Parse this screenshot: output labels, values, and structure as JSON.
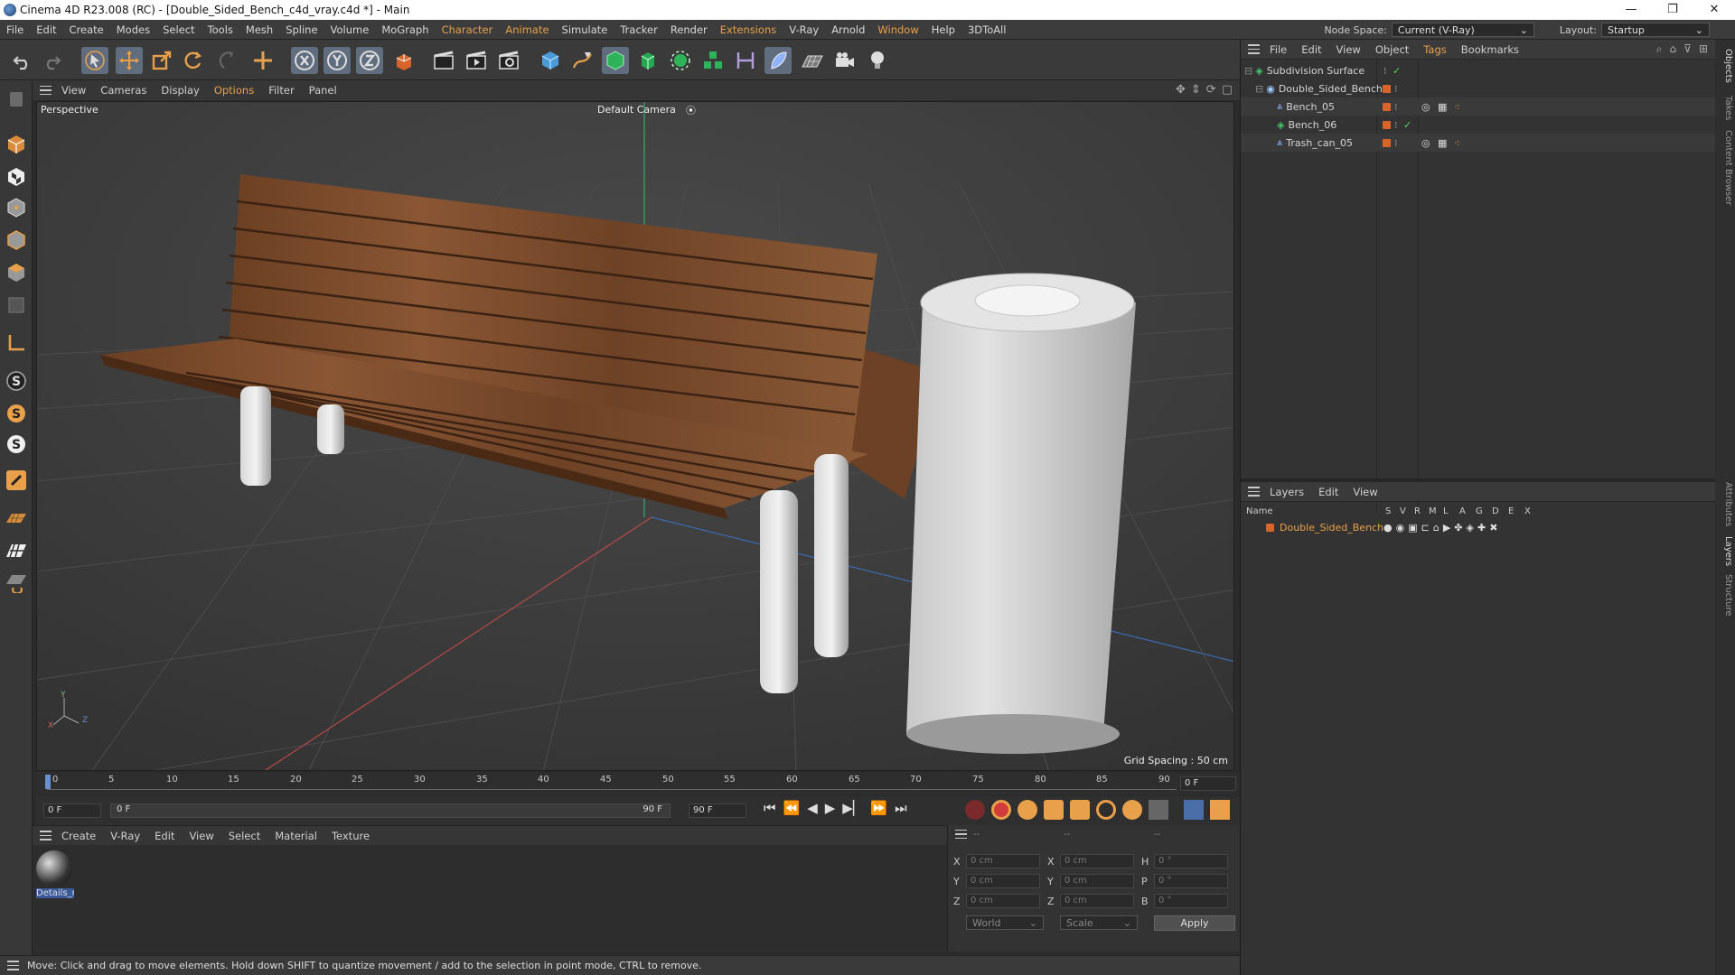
{
  "window": {
    "title": "Cinema 4D R23.008 (RC) - [Double_Sided_Bench_c4d_vray.c4d *] - Main",
    "min": "—",
    "max": "❐",
    "close": "✕"
  },
  "menu": [
    "File",
    "Edit",
    "Create",
    "Modes",
    "Select",
    "Tools",
    "Mesh",
    "Spline",
    "Volume",
    "MoGraph",
    "Character",
    "Animate",
    "Simulate",
    "Tracker",
    "Render",
    "Extensions",
    "V-Ray",
    "Arnold",
    "Window",
    "Help",
    "3DToAll"
  ],
  "node_space": {
    "label": "Node Space:",
    "value": "Current (V-Ray)"
  },
  "layout": {
    "label": "Layout:",
    "value": "Startup"
  },
  "viewport_menu": [
    "View",
    "Cameras",
    "Display",
    "Options",
    "Filter",
    "Panel"
  ],
  "viewport": {
    "name": "Perspective",
    "camera": "Default Camera",
    "grid_spacing": "Grid Spacing : 50 cm",
    "axis_y": "Y",
    "axis_x": "X",
    "axis_z": "Z"
  },
  "timeline": {
    "ticks": [
      "0",
      "5",
      "10",
      "15",
      "20",
      "25",
      "30",
      "35",
      "40",
      "45",
      "50",
      "55",
      "60",
      "65",
      "70",
      "75",
      "80",
      "85",
      "90"
    ],
    "current": "0 F"
  },
  "transport": {
    "start": "0 F",
    "range_start": "0 F",
    "range_end": "90 F",
    "end": "90 F"
  },
  "material_menu": [
    "Create",
    "V-Ray",
    "Edit",
    "View",
    "Select",
    "Material",
    "Texture"
  ],
  "materials": [
    {
      "name": "Details_r"
    }
  ],
  "coords": {
    "rows": [
      {
        "a": "X",
        "av": "0 cm",
        "b": "X",
        "bv": "0 cm",
        "c": "H",
        "cv": "0 °"
      },
      {
        "a": "Y",
        "av": "0 cm",
        "b": "Y",
        "bv": "0 cm",
        "c": "P",
        "cv": "0 °"
      },
      {
        "a": "Z",
        "av": "0 cm",
        "b": "Z",
        "bv": "0 cm",
        "c": "B",
        "cv": "0 °"
      }
    ],
    "head1": "--",
    "head2": "--",
    "head3": "--",
    "space": "World",
    "mode": "Scale",
    "apply": "Apply"
  },
  "status": "Move: Click and drag to move elements. Hold down SHIFT to quantize movement / add to the selection in point mode, CTRL to remove.",
  "objects_menu": [
    "File",
    "Edit",
    "View",
    "Object",
    "Tags",
    "Bookmarks"
  ],
  "objects": [
    {
      "name": "Subdivision Surface",
      "indent": 0
    },
    {
      "name": "Double_Sided_Bench",
      "indent": 1
    },
    {
      "name": "Bench_05",
      "indent": 2
    },
    {
      "name": "Bench_06",
      "indent": 2
    },
    {
      "name": "Trash_can_05",
      "indent": 2
    }
  ],
  "layers_menu": [
    "Layers",
    "Edit",
    "View"
  ],
  "layers_header": {
    "name": "Name",
    "cols": [
      "S",
      "V",
      "R",
      "M",
      "L",
      "A",
      "G",
      "D",
      "E",
      "X"
    ]
  },
  "layers": [
    {
      "name": "Double_Sided_Bench"
    }
  ],
  "side_tabs": [
    "Objects",
    "Takes",
    "Content Browser",
    "Attributes",
    "Layers",
    "Structure"
  ],
  "colors": {
    "accent": "#e8a04a",
    "layer": "#d7652a",
    "bg": "#2b2b2b"
  }
}
